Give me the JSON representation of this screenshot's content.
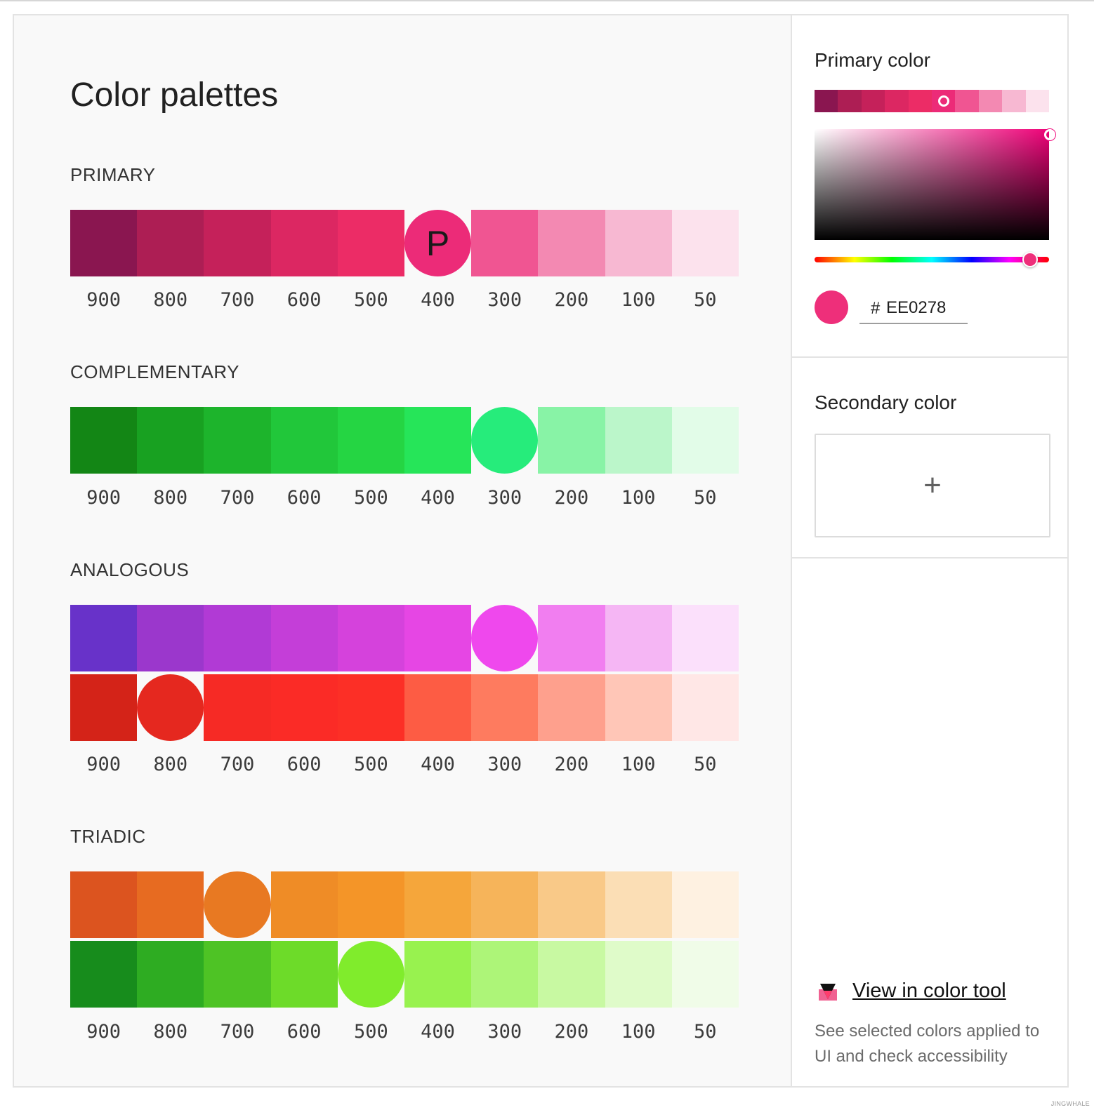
{
  "page_title": "Color palettes",
  "shade_labels": [
    "900",
    "800",
    "700",
    "600",
    "500",
    "400",
    "300",
    "200",
    "100",
    "50"
  ],
  "sections": {
    "primary": {
      "label": "PRIMARY",
      "rows": [
        {
          "colors": [
            "#8a1650",
            "#ad1e54",
            "#c5215a",
            "#dc2762",
            "#ec2c66",
            "#ec2b78",
            "#f05592",
            "#f389b2",
            "#f7b8d2",
            "#fce2ed"
          ],
          "circle_index": 5,
          "marker": "P"
        }
      ]
    },
    "complementary": {
      "label": "COMPLEMENTARY",
      "rows": [
        {
          "colors": [
            "#138615",
            "#18a121",
            "#1db42c",
            "#21c73a",
            "#25d543",
            "#26e559",
            "#26ec7b",
            "#88f3a6",
            "#bbf6ca",
            "#e2fce8"
          ],
          "circle_index": 6
        }
      ]
    },
    "analogous": {
      "label": "ANALOGOUS",
      "rows": [
        {
          "colors": [
            "#6832c9",
            "#9b37cc",
            "#b13ad5",
            "#c43ed8",
            "#d542dc",
            "#e646e4",
            "#ef48ed",
            "#f17ef0",
            "#f5b6f4",
            "#fbe0fb"
          ],
          "circle_index": 6
        },
        {
          "colors": [
            "#d42318",
            "#e5281f",
            "#f62a25",
            "#fb2b26",
            "#fc2f26",
            "#fd5c44",
            "#fe7b5f",
            "#fea08d",
            "#ffc6b7",
            "#ffe7e6"
          ],
          "circle_index": 1
        }
      ]
    },
    "triadic": {
      "label": "TRIADIC",
      "rows": [
        {
          "colors": [
            "#dc541f",
            "#e76b21",
            "#e87922",
            "#ef8c26",
            "#f49528",
            "#f5a63b",
            "#f6b45a",
            "#f9c988",
            "#fbdeb5",
            "#fef1e1"
          ],
          "circle_index": 2
        },
        {
          "colors": [
            "#178c1c",
            "#2eac22",
            "#4ec325",
            "#6ddb29",
            "#80ec2c",
            "#98f24f",
            "#adf578",
            "#c8f9a2",
            "#dffbc9",
            "#f0fce8"
          ],
          "circle_index": 4
        }
      ]
    }
  },
  "primary_panel": {
    "title": "Primary color",
    "strip_colors": [
      "#8a1650",
      "#ad1e54",
      "#c5215a",
      "#dc2762",
      "#ec2c66",
      "#ec2b78",
      "#f05592",
      "#f389b2",
      "#f7b8d2",
      "#fce2ed"
    ],
    "selected_strip_index": 5,
    "hex_prefix": "#",
    "hex_value": "EE0278",
    "swatch_color": "#ee2f7a",
    "hue_position": 0.92
  },
  "secondary_panel": {
    "title": "Secondary color",
    "add_glyph": "+"
  },
  "color_tool": {
    "link_label": "View in color tool",
    "icon": "color-tool-icon",
    "description": "See selected colors applied to UI and check accessibility"
  },
  "watermark": "JINGWHALE"
}
